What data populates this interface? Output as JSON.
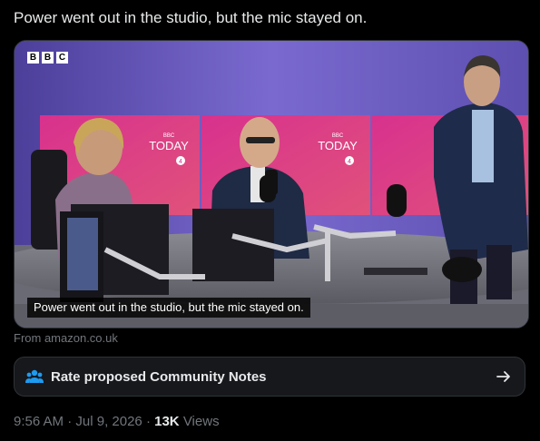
{
  "tweet": {
    "text": "Power went out in the studio, but the mic stayed on."
  },
  "media": {
    "logo_letters": [
      "B",
      "B",
      "C"
    ],
    "screen_brand_small": "BBC",
    "screen_brand": "TODAY",
    "screen_channel": "4",
    "caption": "Power went out in the studio, but the mic stayed on."
  },
  "source": "From amazon.co.uk",
  "community_notes": {
    "label": "Rate proposed Community Notes",
    "icon": "people-icon",
    "arrow_icon": "arrow-right-icon",
    "accent": "#1d9bf0"
  },
  "meta": {
    "time": "9:56 AM",
    "sep1": " · ",
    "date": "Jul 9, 2026",
    "sep2": " · ",
    "views_count": "13K",
    "views_label": " Views"
  }
}
